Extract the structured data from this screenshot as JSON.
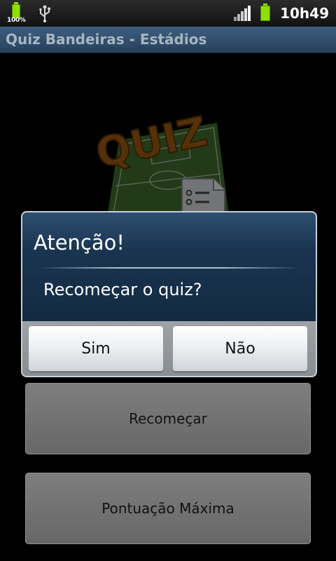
{
  "status_bar": {
    "battery_small_text": "100%",
    "time": "10h49"
  },
  "app": {
    "title": "Quiz Bandeiras - Estádios"
  },
  "logo": {
    "text": "QUIZ"
  },
  "dialog": {
    "title": "Atenção!",
    "message": "Recomeçar o quiz?",
    "yes_label": "Sim",
    "no_label": "Não"
  },
  "menu": {
    "restart_label": "Recomeçar",
    "highscore_label": "Pontuação Máxima"
  },
  "colors": {
    "battery": "#8ee000",
    "dialog_header": "#1a3450",
    "title_bar": "#2f4c6b"
  }
}
